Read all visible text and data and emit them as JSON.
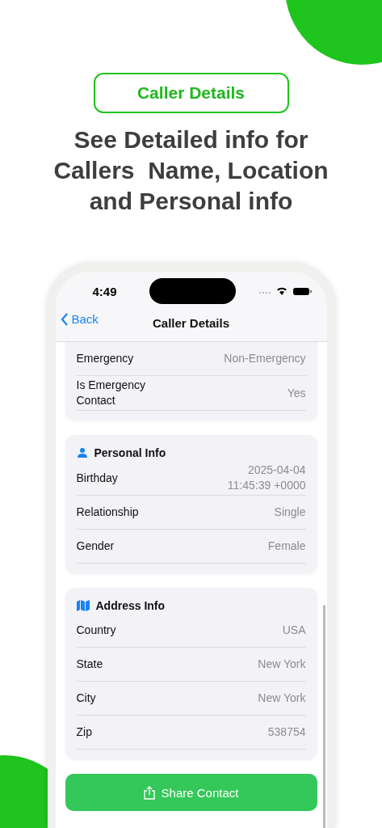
{
  "badge": "Caller Details",
  "headline": [
    "See Detailed info for",
    "Callers  Name, Location",
    "and Personal info"
  ],
  "status_bar": {
    "time": "4:49"
  },
  "nav": {
    "back": "Back",
    "title": "Caller Details"
  },
  "sections": [
    {
      "rows": [
        {
          "label": "Emergency",
          "value": "Non-Emergency"
        },
        {
          "label": "Is Emergency Contact",
          "value": "Yes"
        }
      ]
    },
    {
      "title": "Personal Info",
      "rows": [
        {
          "label": "Birthday",
          "value": "2025-04-04 11:45:39 +0000"
        },
        {
          "label": "Relationship",
          "value": "Single"
        },
        {
          "label": "Gender",
          "value": "Female"
        }
      ]
    },
    {
      "title": "Address Info",
      "rows": [
        {
          "label": "Country",
          "value": "USA"
        },
        {
          "label": "State",
          "value": "New York"
        },
        {
          "label": "City",
          "value": "New York"
        },
        {
          "label": "Zip",
          "value": "538754"
        }
      ]
    }
  ],
  "share_button": "Share Contact"
}
